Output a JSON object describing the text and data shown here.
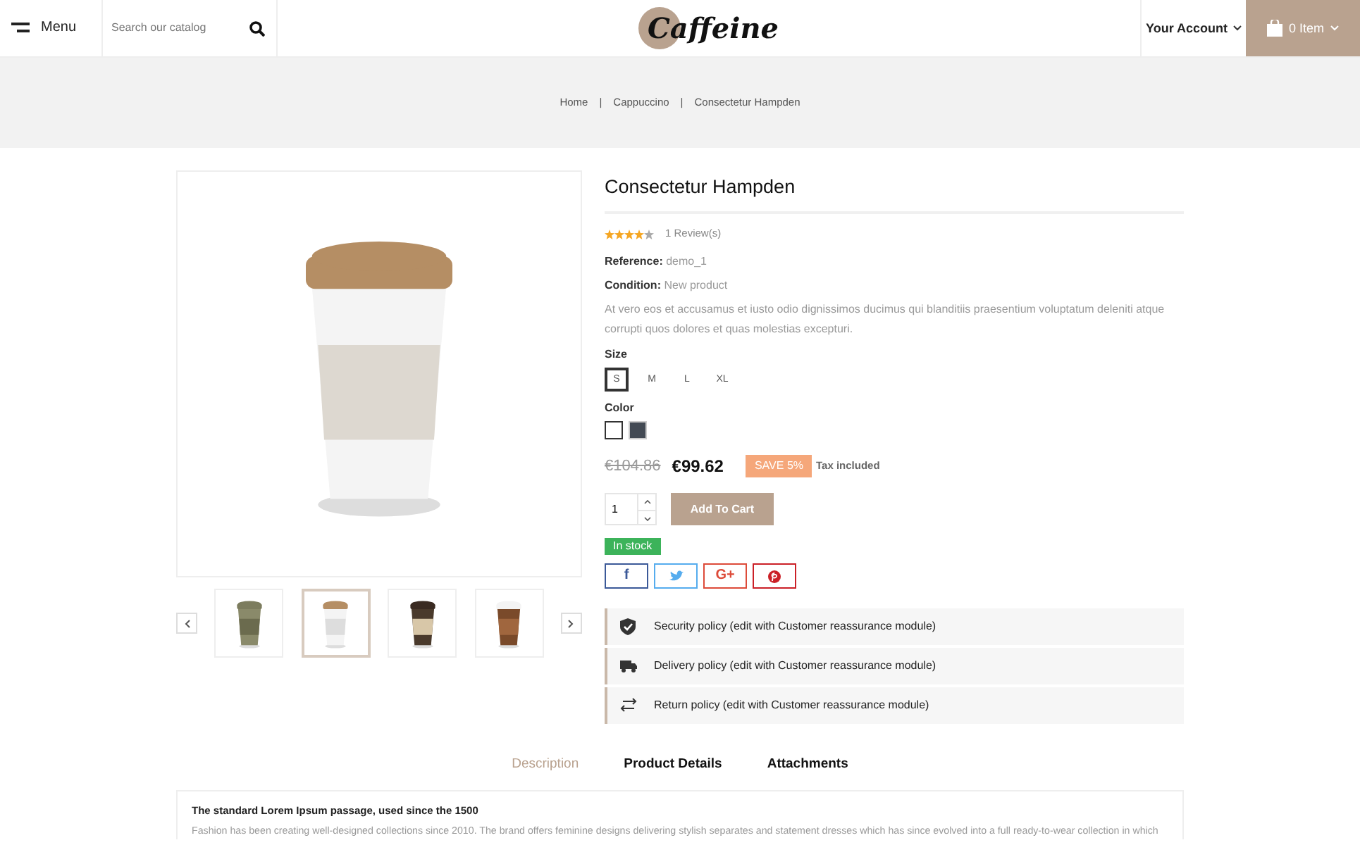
{
  "header": {
    "menu_label": "Menu",
    "search": {
      "placeholder": "Search our catalog"
    },
    "logo": "Caffeine",
    "account_label": "Your Account",
    "cart_label": "0 Item"
  },
  "breadcrumb": [
    {
      "label": "Home",
      "separator": "|"
    },
    {
      "label": "Cappuccino",
      "separator": "|"
    },
    {
      "label": "Consectetur Hampden"
    }
  ],
  "gallery": {
    "thumbnails": [
      {
        "selected": false
      },
      {
        "selected": true
      },
      {
        "selected": false
      },
      {
        "selected": false
      }
    ]
  },
  "product": {
    "title": "Consectetur Hampden",
    "stars": 4,
    "reviews": "1 Review(s)",
    "reference_label": "Reference:",
    "reference": "demo_1",
    "condition_label": "Condition:",
    "condition": "New product",
    "description": "At vero eos et accusamus et iusto odio dignissimos ducimus qui blanditiis praesentium voluptatum deleniti atque corrupti quos dolores et quas molestias excepturi.",
    "size_label": "Size",
    "sizes": [
      {
        "label": "S",
        "selected": true
      },
      {
        "label": "M",
        "selected": false
      },
      {
        "label": "L",
        "selected": false
      },
      {
        "label": "XL",
        "selected": false
      }
    ],
    "color_label": "Color",
    "colors": [
      {
        "color": "#ffffff",
        "selected": true
      },
      {
        "color": "#434a54",
        "selected": false
      }
    ],
    "old_price": "€104.86",
    "price": "€99.62",
    "discount": "SAVE 5%",
    "tax": "Tax included",
    "quantity": "1",
    "add_to_cart": "Add To Cart",
    "stock": "In stock",
    "social": [
      {
        "kind": "facebook",
        "label": "f"
      },
      {
        "kind": "twitter"
      },
      {
        "kind": "googleplus",
        "label": "G+"
      },
      {
        "kind": "pinterest"
      }
    ],
    "policies": [
      {
        "kind": "security",
        "text": "Security policy (edit with Customer reassurance module)"
      },
      {
        "kind": "delivery",
        "text": "Delivery policy (edit with Customer reassurance module)"
      },
      {
        "kind": "return",
        "text": "Return policy (edit with Customer reassurance module)"
      }
    ]
  },
  "tabs": [
    {
      "label": "Description",
      "selected": true
    },
    {
      "label": "Product Details",
      "selected": false
    },
    {
      "label": "Attachments",
      "selected": false
    }
  ],
  "description_panel": {
    "heading": "The standard Lorem Ipsum passage, used since the 1500",
    "text": "Fashion has been creating well-designed collections since 2010. The brand offers feminine designs delivering stylish separates and statement dresses which has since evolved into a full ready-to-wear collection in which"
  }
}
